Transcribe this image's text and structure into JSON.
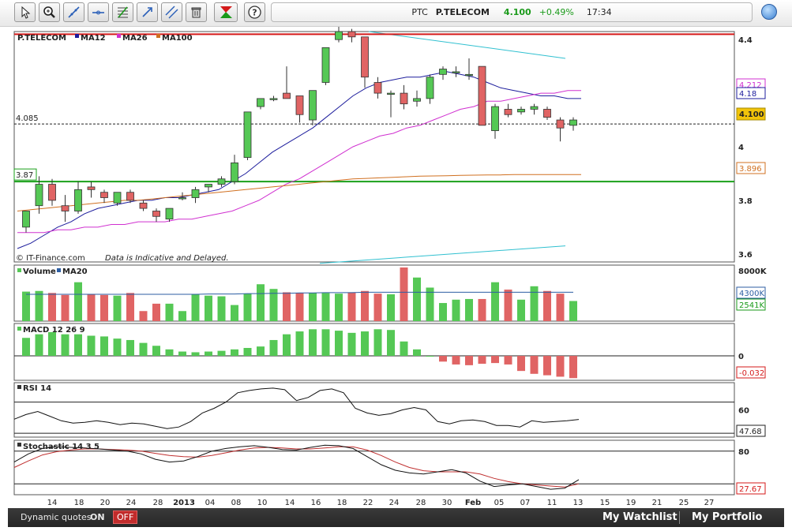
{
  "toolbar": {
    "tools": [
      {
        "name": "pointer-tool",
        "icon": "pointer-icon"
      },
      {
        "name": "zoom-tool",
        "icon": "zoom-icon"
      },
      {
        "name": "trendline-tool",
        "icon": "trendline-icon"
      },
      {
        "name": "horizontal-line-tool",
        "icon": "horizontal-line-icon"
      },
      {
        "name": "fibonacci-tool",
        "icon": "fibonacci-icon"
      },
      {
        "name": "arrow-tool",
        "icon": "arrow-icon"
      },
      {
        "name": "channel-tool",
        "icon": "channel-icon"
      },
      {
        "name": "delete-tool",
        "icon": "trash-icon"
      },
      {
        "name": "chart-type-tool",
        "icon": "chart-type-icon"
      },
      {
        "name": "help-tool",
        "icon": "help-icon"
      }
    ]
  },
  "quote": {
    "symbol": "PTC",
    "name": "P.TELECOM",
    "price": "4.100",
    "change": "+0.49%",
    "time": "17:34"
  },
  "colors": {
    "up": "#55c855",
    "down": "#e06464",
    "ma12": "#1c1c9c",
    "ma26": "#d030d0",
    "ma100": "#d07020",
    "support": "#1aa01a",
    "resistance": "#d41a1a",
    "channel": "#30c0d0"
  },
  "chart_data": [
    {
      "type": "candlestick",
      "title": "P.TELECOM",
      "legend": [
        "MA12",
        "MA26",
        "MA100"
      ],
      "source": "© IT-Finance.com",
      "disclaimer": "Data is Indicative and Delayed.",
      "yticks": [
        "4.4",
        "4.2",
        "4",
        "3.8",
        "3.6"
      ],
      "ylim": [
        3.57,
        4.43
      ],
      "levels": [
        {
          "label": "4.085",
          "value": 4.085,
          "style": "dashed"
        },
        {
          "label": "3.87",
          "value": 3.87,
          "style": "support"
        },
        {
          "value": 4.42,
          "style": "resistance"
        }
      ],
      "value_tags": [
        {
          "label": "4.212",
          "value": 4.212,
          "series": "MA26"
        },
        {
          "label": "4.18",
          "value": 4.18,
          "series": "MA12"
        },
        {
          "label": "4.100",
          "value": 4.1,
          "series": "price"
        },
        {
          "label": "3.896",
          "value": 3.896,
          "series": "MA100"
        }
      ],
      "xlabels": [
        "14",
        "18",
        "20",
        "24",
        "28",
        "2013",
        "04",
        "08",
        "10",
        "14",
        "16",
        "18",
        "22",
        "24",
        "28",
        "30",
        "Feb",
        "05",
        "07",
        "11",
        "13",
        "15",
        "19",
        "21",
        "25",
        "27"
      ],
      "candles": [
        {
          "o": 3.7,
          "h": 3.75,
          "l": 3.68,
          "c": 3.76
        },
        {
          "o": 3.78,
          "h": 3.89,
          "l": 3.75,
          "c": 3.86
        },
        {
          "o": 3.86,
          "h": 3.88,
          "l": 3.78,
          "c": 3.8
        },
        {
          "o": 3.78,
          "h": 3.82,
          "l": 3.72,
          "c": 3.76
        },
        {
          "o": 3.76,
          "h": 3.87,
          "l": 3.75,
          "c": 3.84
        },
        {
          "o": 3.85,
          "h": 3.87,
          "l": 3.81,
          "c": 3.84
        },
        {
          "o": 3.83,
          "h": 3.84,
          "l": 3.79,
          "c": 3.81
        },
        {
          "o": 3.79,
          "h": 3.83,
          "l": 3.78,
          "c": 3.83
        },
        {
          "o": 3.83,
          "h": 3.84,
          "l": 3.79,
          "c": 3.8
        },
        {
          "o": 3.79,
          "h": 3.8,
          "l": 3.76,
          "c": 3.77
        },
        {
          "o": 3.76,
          "h": 3.77,
          "l": 3.72,
          "c": 3.74
        },
        {
          "o": 3.73,
          "h": 3.77,
          "l": 3.72,
          "c": 3.77
        },
        {
          "o": 3.81,
          "h": 3.83,
          "l": 3.8,
          "c": 3.81
        },
        {
          "o": 3.81,
          "h": 3.85,
          "l": 3.79,
          "c": 3.84
        },
        {
          "o": 3.85,
          "h": 3.86,
          "l": 3.83,
          "c": 3.86
        },
        {
          "o": 3.86,
          "h": 3.89,
          "l": 3.85,
          "c": 3.88
        },
        {
          "o": 3.87,
          "h": 3.97,
          "l": 3.86,
          "c": 3.94
        },
        {
          "o": 3.96,
          "h": 4.13,
          "l": 3.95,
          "c": 4.13
        },
        {
          "o": 4.15,
          "h": 4.18,
          "l": 4.14,
          "c": 4.18
        },
        {
          "o": 4.18,
          "h": 4.19,
          "l": 4.17,
          "c": 4.18
        },
        {
          "o": 4.2,
          "h": 4.3,
          "l": 4.19,
          "c": 4.18
        },
        {
          "o": 4.19,
          "h": 4.19,
          "l": 4.09,
          "c": 4.12
        },
        {
          "o": 4.1,
          "h": 4.21,
          "l": 4.08,
          "c": 4.21
        },
        {
          "o": 4.24,
          "h": 4.37,
          "l": 4.23,
          "c": 4.37
        },
        {
          "o": 4.4,
          "h": 4.45,
          "l": 4.39,
          "c": 4.43
        },
        {
          "o": 4.43,
          "h": 4.44,
          "l": 4.39,
          "c": 4.41
        },
        {
          "o": 4.41,
          "h": 4.41,
          "l": 4.22,
          "c": 4.26
        },
        {
          "o": 4.24,
          "h": 4.26,
          "l": 4.18,
          "c": 4.2
        },
        {
          "o": 4.2,
          "h": 4.21,
          "l": 4.11,
          "c": 4.2
        },
        {
          "o": 4.2,
          "h": 4.23,
          "l": 4.14,
          "c": 4.16
        },
        {
          "o": 4.17,
          "h": 4.21,
          "l": 4.15,
          "c": 4.18
        },
        {
          "o": 4.18,
          "h": 4.27,
          "l": 4.16,
          "c": 4.26
        },
        {
          "o": 4.27,
          "h": 4.3,
          "l": 4.25,
          "c": 4.29
        },
        {
          "o": 4.28,
          "h": 4.3,
          "l": 4.26,
          "c": 4.28
        },
        {
          "o": 4.27,
          "h": 4.33,
          "l": 4.25,
          "c": 4.27
        },
        {
          "o": 4.3,
          "h": 4.3,
          "l": 4.08,
          "c": 4.08
        },
        {
          "o": 4.06,
          "h": 4.16,
          "l": 4.03,
          "c": 4.15
        },
        {
          "o": 4.14,
          "h": 4.16,
          "l": 4.11,
          "c": 4.12
        },
        {
          "o": 4.13,
          "h": 4.15,
          "l": 4.12,
          "c": 4.14
        },
        {
          "o": 4.14,
          "h": 4.16,
          "l": 4.12,
          "c": 4.15
        },
        {
          "o": 4.14,
          "h": 4.15,
          "l": 4.1,
          "c": 4.11
        },
        {
          "o": 4.1,
          "h": 4.11,
          "l": 4.02,
          "c": 4.07
        },
        {
          "o": 4.08,
          "h": 4.11,
          "l": 4.06,
          "c": 4.1
        }
      ],
      "series": [
        {
          "name": "MA12",
          "values": [
            3.62,
            3.64,
            3.67,
            3.7,
            3.72,
            3.75,
            3.77,
            3.78,
            3.79,
            3.8,
            3.8,
            3.81,
            3.81,
            3.82,
            3.83,
            3.84,
            3.87,
            3.9,
            3.94,
            3.98,
            4.01,
            4.04,
            4.07,
            4.11,
            4.15,
            4.19,
            4.22,
            4.24,
            4.25,
            4.26,
            4.26,
            4.27,
            4.28,
            4.27,
            4.26,
            4.24,
            4.22,
            4.21,
            4.2,
            4.19,
            4.19,
            4.18,
            4.18
          ]
        },
        {
          "name": "MA26",
          "values": [
            3.68,
            3.68,
            3.68,
            3.69,
            3.69,
            3.7,
            3.7,
            3.71,
            3.71,
            3.72,
            3.72,
            3.72,
            3.73,
            3.73,
            3.74,
            3.75,
            3.76,
            3.78,
            3.8,
            3.83,
            3.86,
            3.88,
            3.91,
            3.94,
            3.97,
            4.0,
            4.02,
            4.04,
            4.05,
            4.07,
            4.08,
            4.1,
            4.12,
            4.14,
            4.15,
            4.17,
            4.17,
            4.18,
            4.19,
            4.2,
            4.2,
            4.21,
            4.21
          ]
        },
        {
          "name": "MA100",
          "values": [
            3.76,
            3.765,
            3.77,
            3.775,
            3.78,
            3.785,
            3.79,
            3.795,
            3.8,
            3.8,
            3.805,
            3.81,
            3.815,
            3.82,
            3.825,
            3.83,
            3.835,
            3.84,
            3.845,
            3.85,
            3.855,
            3.86,
            3.865,
            3.87,
            3.875,
            3.88,
            3.882,
            3.884,
            3.886,
            3.888,
            3.89,
            3.891,
            3.892,
            3.893,
            3.894,
            3.895,
            3.895,
            3.896,
            3.896,
            3.896,
            3.896,
            3.896,
            3.896
          ]
        }
      ]
    },
    {
      "type": "bar",
      "title": "Volume",
      "legend": [
        "Volume",
        "MA20"
      ],
      "yticks": [
        "8000K"
      ],
      "ylim": [
        0,
        8000
      ],
      "value_tags": [
        {
          "label": "4300K",
          "value": 4300,
          "series": "MA20"
        },
        {
          "label": "2541K",
          "value": 2541,
          "series": "Volume"
        }
      ],
      "values": [
        4400,
        4500,
        4200,
        3900,
        5800,
        4000,
        3900,
        3800,
        4200,
        1500,
        2600,
        2600,
        1500,
        4000,
        3800,
        3700,
        2400,
        4100,
        5500,
        4800,
        4300,
        4200,
        4200,
        4200,
        4100,
        4300,
        4500,
        4100,
        4000,
        8000,
        6500,
        5000,
        2700,
        3200,
        3300,
        3300,
        5800,
        4700,
        3200,
        5200,
        4500,
        4100,
        3000,
        2600,
        4400,
        4000,
        3900,
        2541
      ],
      "ma20": [
        4000,
        4000,
        4000,
        4000,
        4000,
        4000,
        4000,
        4000,
        4000,
        4000,
        4000,
        4000,
        4000,
        4000,
        4050,
        4050,
        4050,
        4100,
        4100,
        4150,
        4150,
        4200,
        4200,
        4250,
        4250,
        4250,
        4300,
        4300,
        4300,
        4300,
        4300,
        4300,
        4300,
        4300,
        4300,
        4300,
        4300,
        4300,
        4300,
        4300,
        4300,
        4300,
        4300,
        4300,
        4300,
        4300,
        4300,
        4300
      ]
    },
    {
      "type": "bar",
      "title": "MACD 12 26 9",
      "yticks": [
        "0"
      ],
      "ylim": [
        -0.034,
        0.045
      ],
      "value_tags": [
        {
          "label": "-0.032",
          "value": -0.032
        }
      ],
      "values": [
        0.025,
        0.03,
        0.033,
        0.03,
        0.03,
        0.028,
        0.027,
        0.024,
        0.022,
        0.018,
        0.014,
        0.009,
        0.006,
        0.005,
        0.006,
        0.007,
        0.009,
        0.011,
        0.013,
        0.022,
        0.03,
        0.034,
        0.037,
        0.037,
        0.035,
        0.032,
        0.034,
        0.037,
        0.036,
        0.02,
        0.009,
        0,
        -0.008,
        -0.012,
        -0.013,
        -0.011,
        -0.01,
        -0.012,
        -0.021,
        -0.025,
        -0.027,
        -0.029,
        -0.031,
        -0.032
      ]
    },
    {
      "type": "line",
      "title": "RSI 14",
      "yticks": [
        "60"
      ],
      "ylim": [
        25,
        95
      ],
      "levels": [
        70,
        30
      ],
      "value_tags": [
        {
          "label": "47.68",
          "value": 47.68
        }
      ],
      "values": [
        48,
        54,
        58,
        52,
        46,
        43,
        44,
        46,
        44,
        41,
        43,
        42,
        39,
        36,
        38,
        45,
        56,
        62,
        70,
        82,
        85,
        87,
        88,
        86,
        72,
        76,
        85,
        87,
        82,
        62,
        56,
        53,
        55,
        60,
        63,
        60,
        45,
        42,
        46,
        47,
        45,
        40,
        40,
        38,
        46,
        44,
        45,
        46,
        47.68
      ]
    },
    {
      "type": "line",
      "title": "Stochastic 14 3 5",
      "yticks": [
        "80"
      ],
      "ylim": [
        0,
        100
      ],
      "levels": [
        80,
        20
      ],
      "value_tags": [
        {
          "label": "27.67",
          "value": 27.67
        }
      ],
      "series": [
        {
          "name": "%K",
          "values": [
            60,
            75,
            85,
            88,
            87,
            86,
            84,
            82,
            80,
            75,
            65,
            60,
            62,
            70,
            80,
            85,
            88,
            90,
            87,
            83,
            82,
            87,
            91,
            90,
            85,
            70,
            55,
            45,
            40,
            38,
            42,
            46,
            40,
            25,
            15,
            18,
            20,
            15,
            10,
            12,
            27.67
          ]
        },
        {
          "name": "%D",
          "values": [
            50,
            62,
            73,
            79,
            82,
            84,
            84,
            83,
            82,
            80,
            76,
            72,
            70,
            69,
            72,
            77,
            82,
            86,
            87,
            86,
            84,
            84,
            86,
            88,
            88,
            82,
            72,
            60,
            50,
            44,
            42,
            42,
            42,
            38,
            30,
            24,
            20,
            18,
            16,
            14,
            20
          ]
        }
      ]
    }
  ],
  "bottom": {
    "dynamic_quotes_label": "Dynamic quotes",
    "on_label": "ON",
    "off_label": "OFF",
    "watchlist_label": "My Watchlist",
    "portfolio_label": "My Portfolio"
  }
}
